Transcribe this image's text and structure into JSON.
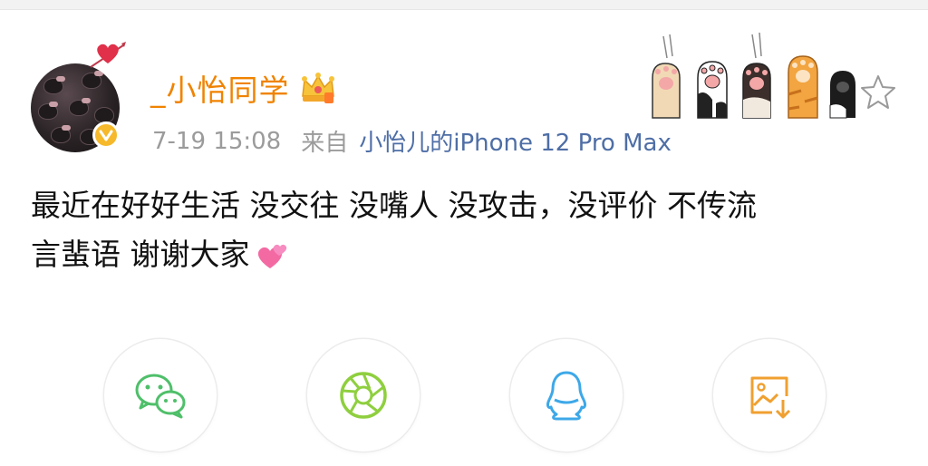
{
  "post": {
    "username": "_小怡同学",
    "time": "7-19 15:08",
    "source_label": "来自",
    "device": "小怡儿的iPhone 12 Pro Max",
    "content_line1": "最近在好好生活 没交往 没嘴人 没攻击，没评价 不传流",
    "content_line2": "言蜚语 谢谢大家"
  },
  "icons": {
    "avatar": "hello-kitty-avatar",
    "verified": "verified-badge-icon",
    "crown": "crown-member-icon",
    "paws": "cat-paws-decoration",
    "favorite": "star-icon",
    "emoji": "two-hearts-emoji"
  },
  "share": {
    "items": [
      {
        "name": "wechat",
        "icon": "wechat-icon",
        "color": "#4fbf6a"
      },
      {
        "name": "moments",
        "icon": "aperture-icon",
        "color": "#8fcf3f"
      },
      {
        "name": "qq",
        "icon": "qq-penguin-icon",
        "color": "#3da8e8"
      },
      {
        "name": "save-image",
        "icon": "save-image-icon",
        "color": "#f0a030"
      }
    ]
  },
  "colors": {
    "username": "#f08300",
    "meta": "#9b9b9b",
    "device": "#4e6ea6",
    "text": "#111111"
  }
}
